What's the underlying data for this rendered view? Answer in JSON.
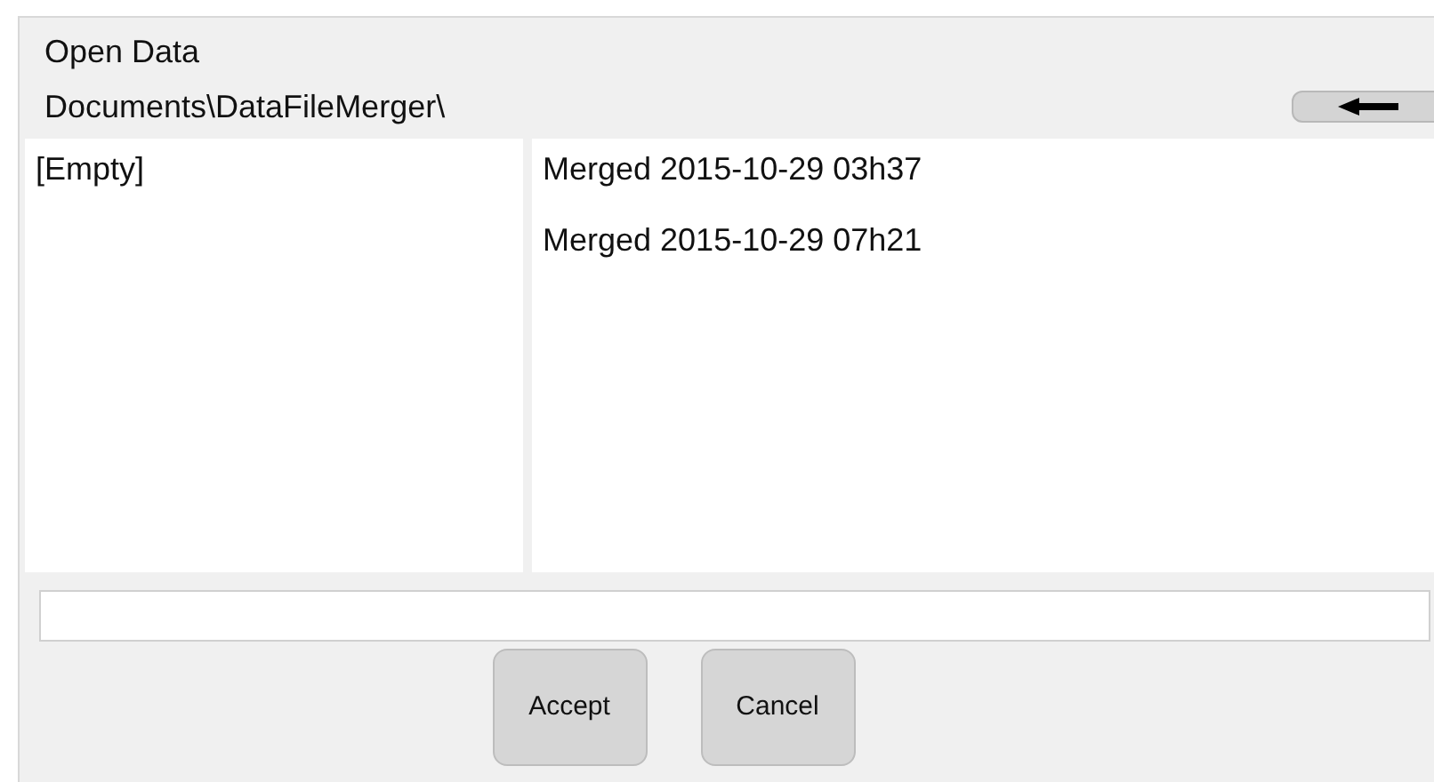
{
  "dialog": {
    "title": "Open Data",
    "path": "Documents\\DataFileMerger\\"
  },
  "folders": [
    {
      "label": "[Empty]",
      "selected": false
    }
  ],
  "files": [
    {
      "label": "Merged 2015-10-29 03h37",
      "selected": false
    },
    {
      "label": "Merged 2015-10-29 07h21",
      "selected": false
    }
  ],
  "buttons": [
    {
      "label": "Accept"
    },
    {
      "label": "Cancel"
    }
  ]
}
